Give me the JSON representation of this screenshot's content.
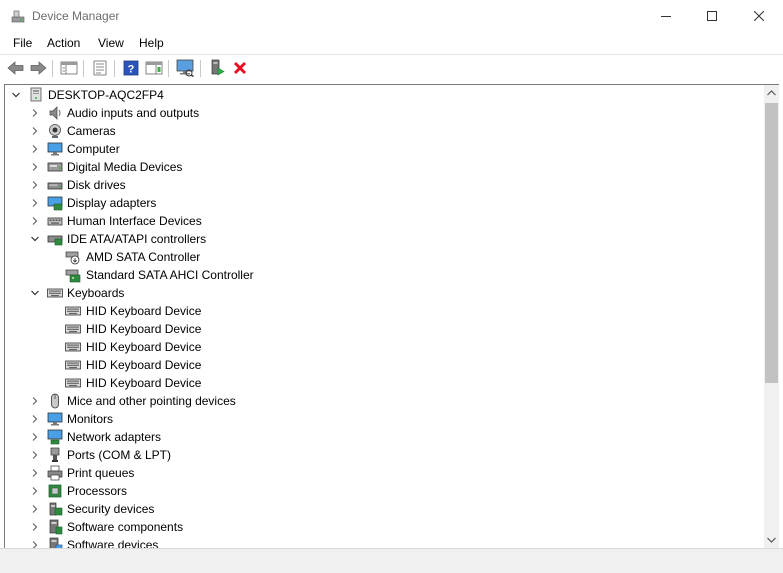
{
  "window": {
    "title": "Device Manager"
  },
  "menu": {
    "file": "File",
    "action": "Action",
    "view": "View",
    "help": "Help"
  },
  "tree": {
    "root": "DESKTOP-AQC2FP4",
    "rows": [
      {
        "label": "Audio inputs and outputs",
        "level": 1,
        "state": "collapsed",
        "icon": "speaker-icon"
      },
      {
        "label": "Cameras",
        "level": 1,
        "state": "collapsed",
        "icon": "camera-icon"
      },
      {
        "label": "Computer",
        "level": 1,
        "state": "collapsed",
        "icon": "computer-icon"
      },
      {
        "label": "Digital Media Devices",
        "level": 1,
        "state": "collapsed",
        "icon": "media-device-icon"
      },
      {
        "label": "Disk drives",
        "level": 1,
        "state": "collapsed",
        "icon": "disk-drive-icon"
      },
      {
        "label": "Display adapters",
        "level": 1,
        "state": "collapsed",
        "icon": "display-adapter-icon"
      },
      {
        "label": "Human Interface Devices",
        "level": 1,
        "state": "collapsed",
        "icon": "hid-icon"
      },
      {
        "label": "IDE ATA/ATAPI controllers",
        "level": 1,
        "state": "expanded",
        "icon": "ide-controller-icon"
      },
      {
        "label": "AMD SATA Controller",
        "level": 2,
        "state": "leaf",
        "icon": "sata-disabled-icon"
      },
      {
        "label": "Standard SATA AHCI Controller",
        "level": 2,
        "state": "leaf",
        "icon": "sata-controller-icon"
      },
      {
        "label": "Keyboards",
        "level": 1,
        "state": "expanded",
        "icon": "keyboard-icon"
      },
      {
        "label": "HID Keyboard Device",
        "level": 2,
        "state": "leaf",
        "icon": "keyboard-icon"
      },
      {
        "label": "HID Keyboard Device",
        "level": 2,
        "state": "leaf",
        "icon": "keyboard-icon"
      },
      {
        "label": "HID Keyboard Device",
        "level": 2,
        "state": "leaf",
        "icon": "keyboard-icon"
      },
      {
        "label": "HID Keyboard Device",
        "level": 2,
        "state": "leaf",
        "icon": "keyboard-icon"
      },
      {
        "label": "HID Keyboard Device",
        "level": 2,
        "state": "leaf",
        "icon": "keyboard-icon"
      },
      {
        "label": "Mice and other pointing devices",
        "level": 1,
        "state": "collapsed",
        "icon": "mouse-icon"
      },
      {
        "label": "Monitors",
        "level": 1,
        "state": "collapsed",
        "icon": "monitor-icon"
      },
      {
        "label": "Network adapters",
        "level": 1,
        "state": "collapsed",
        "icon": "network-adapter-icon"
      },
      {
        "label": "Ports (COM & LPT)",
        "level": 1,
        "state": "collapsed",
        "icon": "port-icon"
      },
      {
        "label": "Print queues",
        "level": 1,
        "state": "collapsed",
        "icon": "printer-icon"
      },
      {
        "label": "Processors",
        "level": 1,
        "state": "collapsed",
        "icon": "processor-icon"
      },
      {
        "label": "Security devices",
        "level": 1,
        "state": "collapsed",
        "icon": "security-device-icon"
      },
      {
        "label": "Software components",
        "level": 1,
        "state": "collapsed",
        "icon": "software-component-icon"
      },
      {
        "label": "Software devices",
        "level": 1,
        "state": "collapsed",
        "icon": "software-device-icon"
      }
    ]
  },
  "colors": {
    "accent": "#0078d7",
    "remove_red": "#e81123"
  }
}
